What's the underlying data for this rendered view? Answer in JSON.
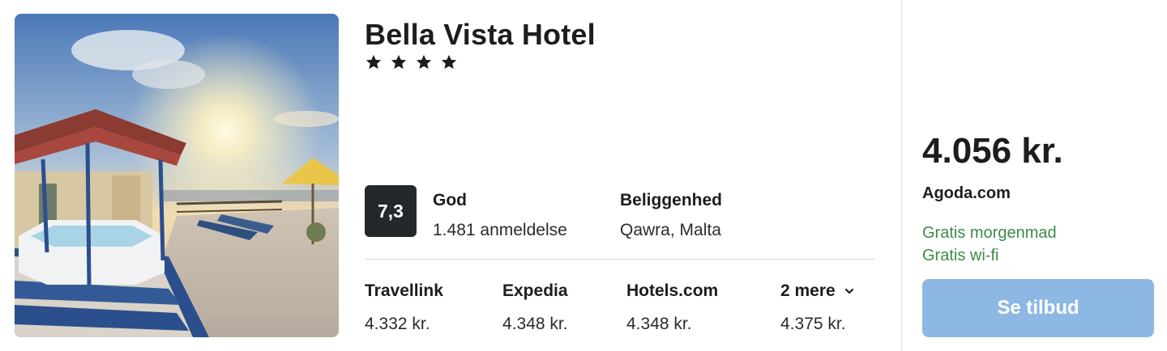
{
  "hotel": {
    "name": "Bella Vista Hotel",
    "star_count": 4,
    "image_alt": "rooftop-jacuzzi-photo"
  },
  "rating": {
    "score": "7,3",
    "word": "God",
    "count": "1.481 anmeldelse"
  },
  "location": {
    "label": "Beliggenhed",
    "value": "Qawra, Malta"
  },
  "providers": [
    {
      "name": "Travellink",
      "price": "4.332 kr."
    },
    {
      "name": "Expedia",
      "price": "4.348 kr."
    },
    {
      "name": "Hotels.com",
      "price": "4.348 kr."
    },
    {
      "name": "2 mere",
      "price": "4.375 kr.",
      "icon": "chevron-down-icon"
    }
  ],
  "offer": {
    "price": "4.056 kr.",
    "source": "Agoda.com",
    "perks": [
      "Gratis morgenmad",
      "Gratis wi-fi"
    ],
    "button_label": "Se tilbud"
  },
  "colors": {
    "badge_bg": "#22282c",
    "perk_green": "#3d8b46",
    "button_bg": "#8cb8e3"
  }
}
